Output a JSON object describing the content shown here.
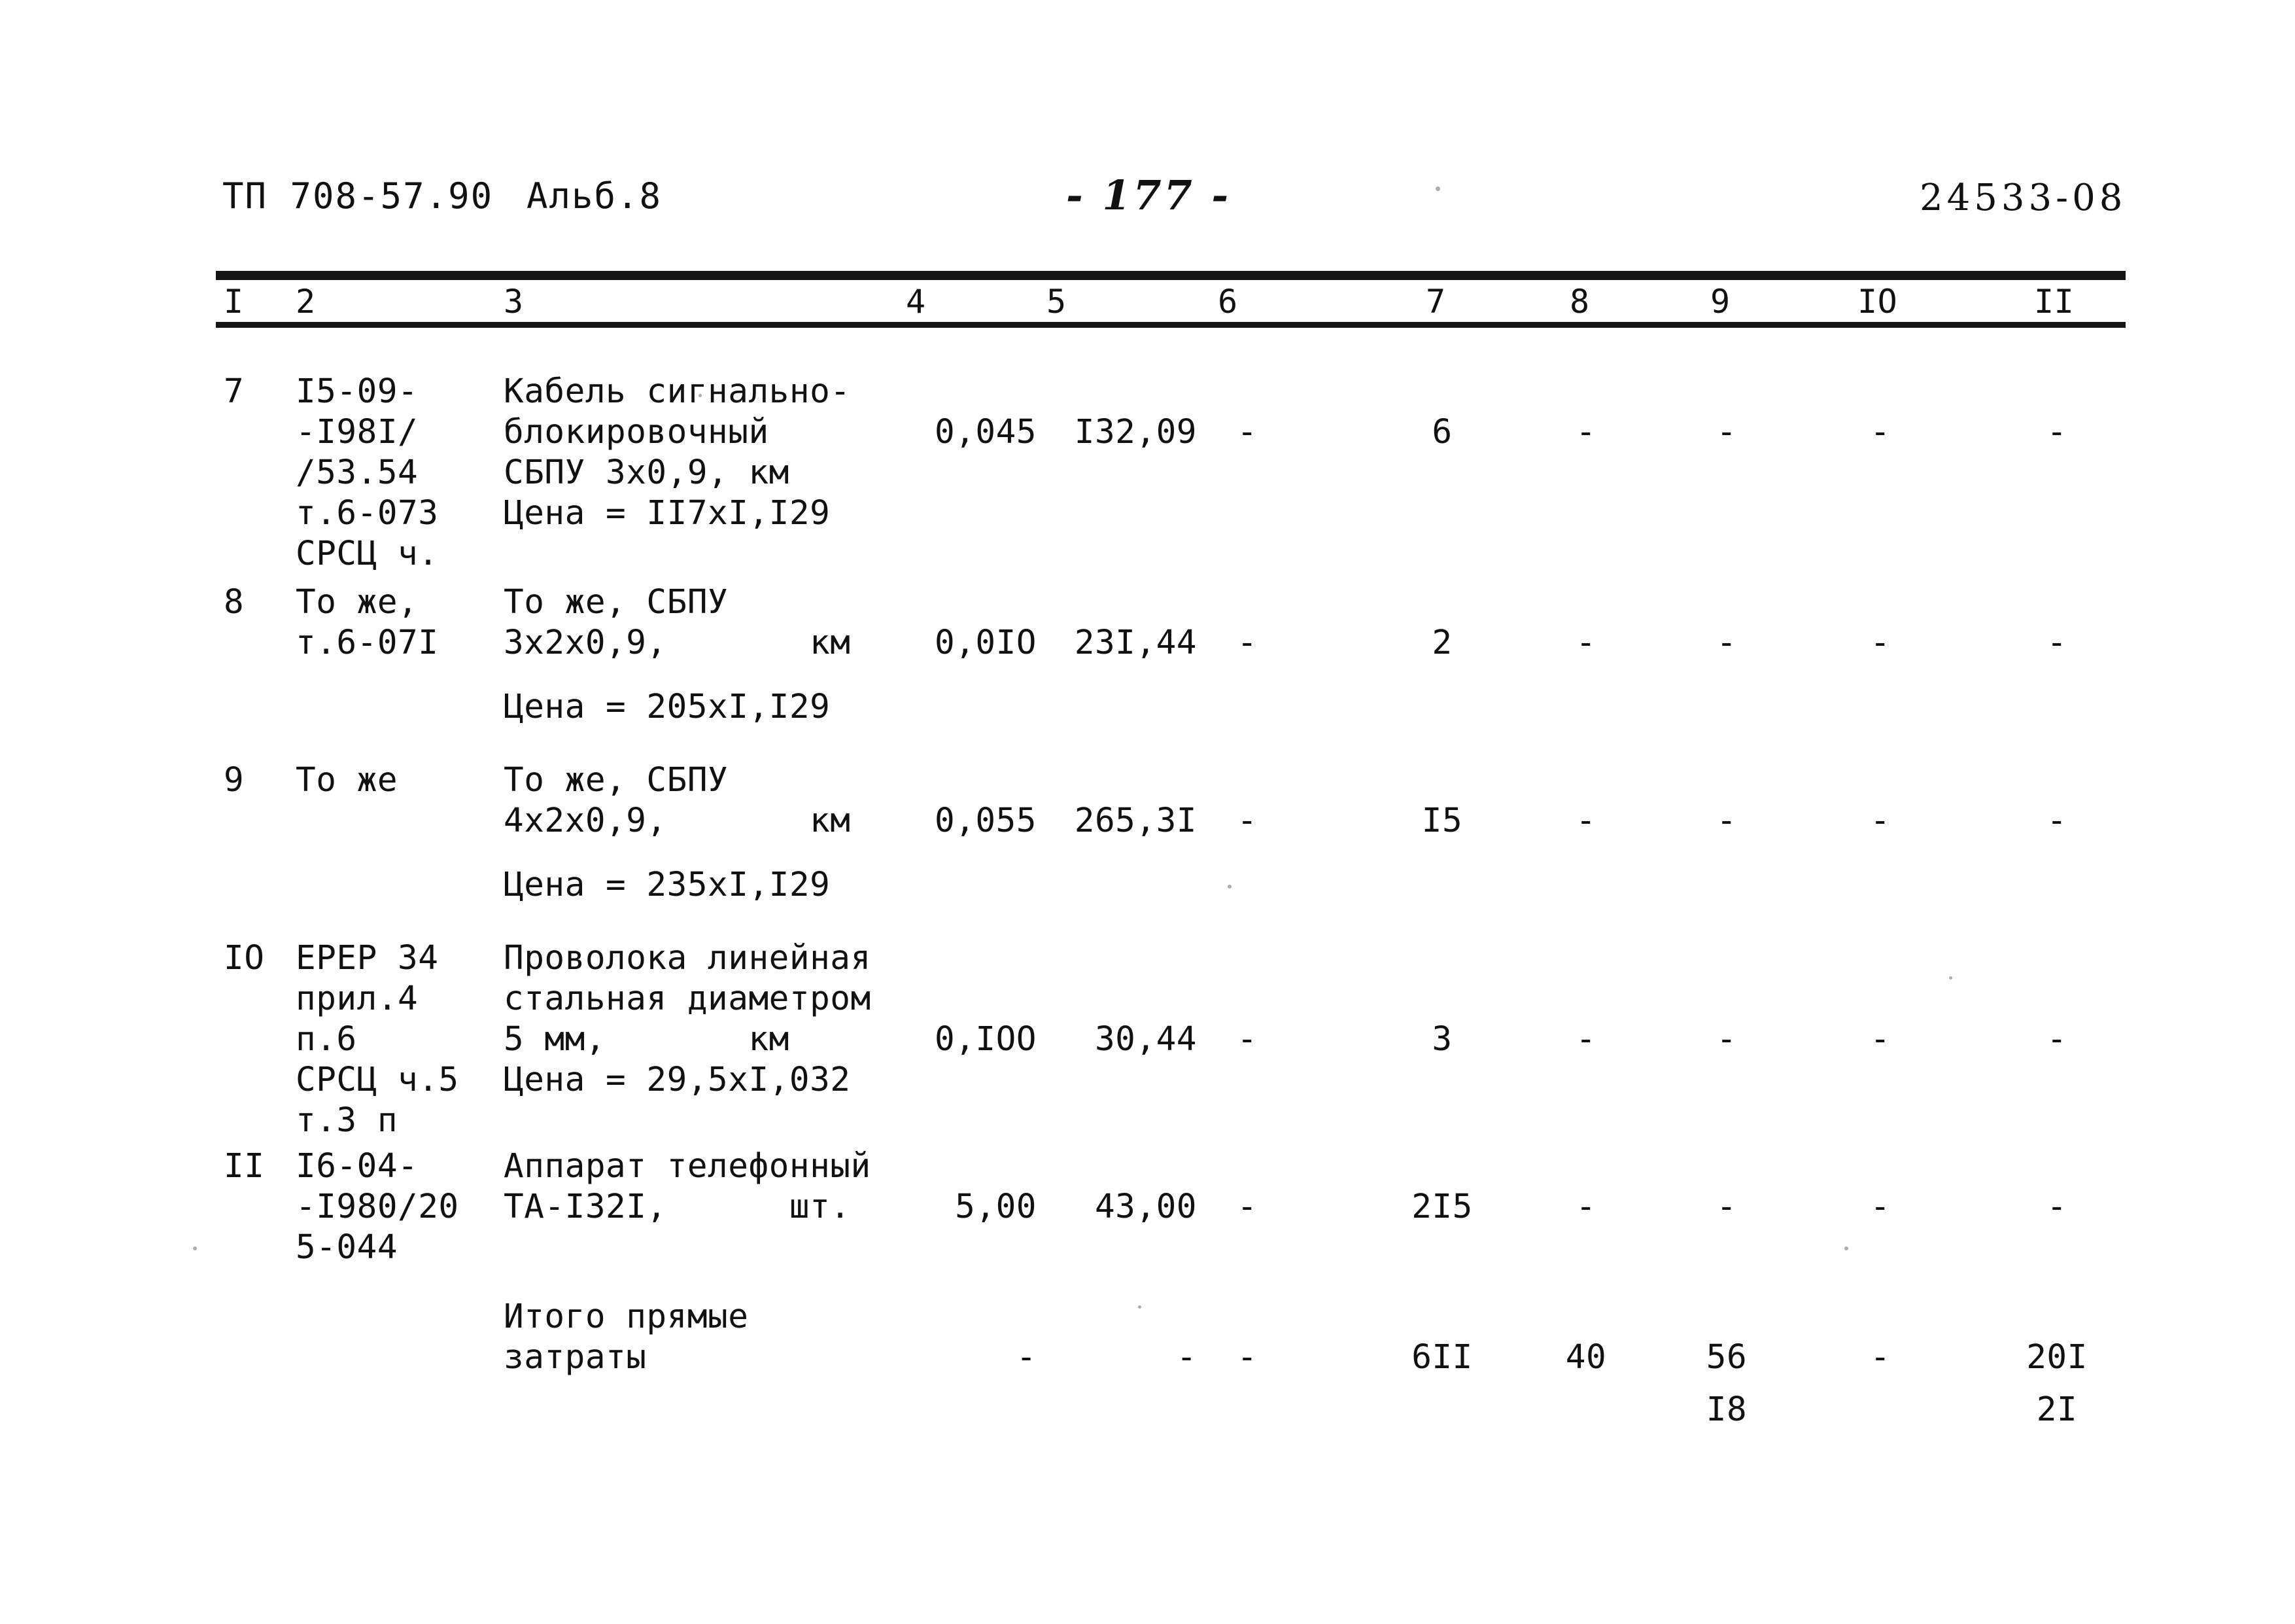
{
  "header": {
    "document_code": "ТП 708-57.90",
    "album": "Альб.8",
    "page_number": "- 177 -",
    "sheet_code": "24533-08"
  },
  "table": {
    "column_headers": [
      "I",
      "2",
      "3",
      "4",
      "5",
      "6",
      "7",
      "8",
      "9",
      "IO",
      "II"
    ],
    "rows": [
      {
        "c1": "7",
        "c2": [
          "I5-09-",
          "-I98I/",
          "/53.54",
          "т.6-073",
          "СРСЦ ч."
        ],
        "c3": [
          "Кабель сигнально-",
          "блокировочный",
          "СБПУ 3х0,9, км"
        ],
        "c3_price": "Цена = II7хI,I29",
        "c4": "0,045",
        "c5": "I32,09",
        "c6": "-",
        "c7": "6",
        "c8": "-",
        "c9": "-",
        "c10": "-",
        "c11": "-"
      },
      {
        "c1": "8",
        "c2": [
          "То же,",
          "т.6-07I"
        ],
        "c3": [
          "То же, СБПУ",
          "3х2х0,9,       км"
        ],
        "c3_price": "Цена = 205хI,I29",
        "c4": "0,0IO",
        "c5": "23I,44",
        "c6": "-",
        "c7": "2",
        "c8": "-",
        "c9": "-",
        "c10": "-",
        "c11": "-"
      },
      {
        "c1": "9",
        "c2": [
          "То же"
        ],
        "c3": [
          "То же, СБПУ",
          "4х2х0,9,       км"
        ],
        "c3_price": "Цена = 235хI,I29",
        "c4": "0,055",
        "c5": "265,3I",
        "c6": "-",
        "c7": "I5",
        "c8": "-",
        "c9": "-",
        "c10": "-",
        "c11": "-"
      },
      {
        "c1": "IO",
        "c2": [
          "ЕРЕР 34",
          "прил.4",
          "п.6",
          "СРСЦ ч.5",
          "т.3 п"
        ],
        "c3": [
          "Проволока линейная",
          "стальная диаметром",
          "5 мм,       км"
        ],
        "c3_price": "Цена = 29,5хI,032",
        "c4": "0,IOO",
        "c5": "30,44",
        "c6": "-",
        "c7": "3",
        "c8": "-",
        "c9": "-",
        "c10": "-",
        "c11": "-"
      },
      {
        "c1": "II",
        "c2": [
          "I6-04-",
          "-I980/20",
          "5-044"
        ],
        "c3": [
          "Аппарат телефонный",
          "ТА-I32I,      шт."
        ],
        "c3_price": "",
        "c4": "5,00",
        "c5": "43,00",
        "c6": "-",
        "c7": "2I5",
        "c8": "-",
        "c9": "-",
        "c10": "-",
        "c11": "-"
      }
    ],
    "total_row": {
      "label_line1": "Итого прямые",
      "label_line2": "затраты",
      "c4": "-",
      "c5": "-",
      "c6": "-",
      "c7": "6II",
      "c8": "40",
      "c9": "56",
      "c9_second": "I8",
      "c10": "-",
      "c11": "20I",
      "c11_second": "2I"
    }
  }
}
